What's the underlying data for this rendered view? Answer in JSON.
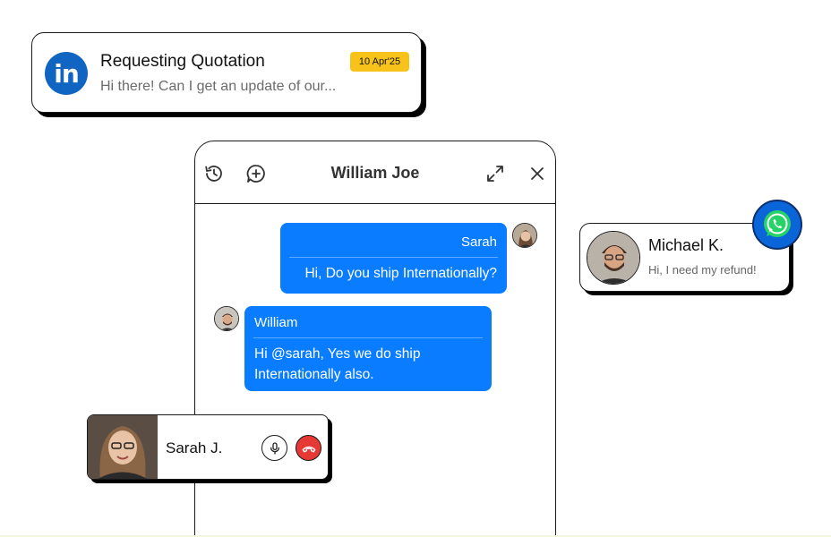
{
  "linkedin_card": {
    "icon": "linkedin-icon",
    "logo_text": "in",
    "title": "Requesting Quotation",
    "preview": "Hi there! Can I get an update of our...",
    "date": "10 Apr'25",
    "brand_color": "#1064c2",
    "date_badge_color": "#f7c31a"
  },
  "chat": {
    "title": "William Joe",
    "header_icons": [
      "history-icon",
      "new-chat-icon",
      "expand-icon",
      "close-icon"
    ],
    "bubble_color": "#0a7cff",
    "messages": [
      {
        "sender": "Sarah",
        "text": "Hi, Do you ship Internationally?",
        "side": "right"
      },
      {
        "sender": "William",
        "text": "Hi @sarah, Yes we do ship Internationally also.",
        "side": "left"
      }
    ]
  },
  "call_card": {
    "name": "Sarah J.",
    "icons": [
      "microphone-icon",
      "end-call-icon"
    ],
    "end_call_color": "#e53935"
  },
  "whatsapp_card": {
    "name": "Michael K.",
    "preview": "Hi, I need my refund!",
    "icon": "whatsapp-icon"
  }
}
